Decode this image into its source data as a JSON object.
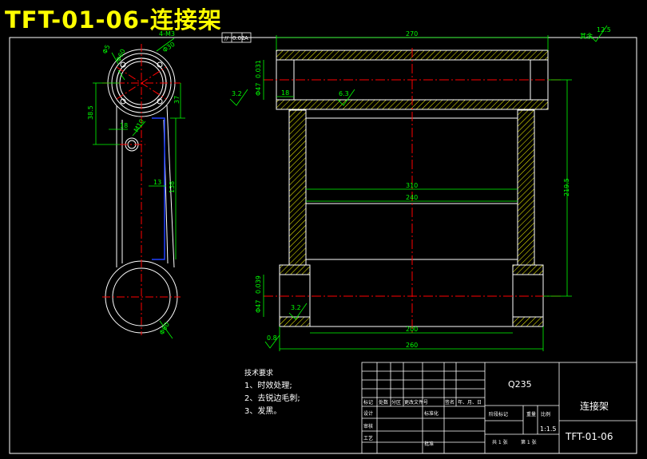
{
  "drawing_title": "TFT-01-06-连接架",
  "left_view": {
    "dims": [
      "4-M3",
      "Φ60",
      "Φ5",
      "Φ30",
      "38.5",
      "37",
      "18",
      "M10",
      "13",
      "138",
      "Φ60"
    ]
  },
  "front_view": {
    "dims_top": [
      "270",
      "18",
      "Φ47",
      "0.031",
      "3.2",
      "6.3"
    ],
    "dims_mid": [
      "310",
      "240",
      "219.5"
    ],
    "dims_bottom": [
      "Φ47",
      "0.039",
      "3.2",
      "200",
      "260",
      "0.8"
    ],
    "tolerance_frame": [
      "//",
      "0.02",
      "A"
    ],
    "roughness_note": [
      "其余",
      "12.5"
    ]
  },
  "technical_requirements": {
    "heading": "技术要求",
    "items": [
      "1、时效处理;",
      "2、去锐边毛刺;",
      "3、发黑。"
    ]
  },
  "title_block": {
    "material": "Q235",
    "part_name": "连接架",
    "drawing_number": "TFT-01-06",
    "scale": "1:1.5",
    "labels": [
      "标记",
      "处数",
      "分区",
      "更改文件号",
      "签名",
      "年、月、日",
      "设计",
      "标准化",
      "审核",
      "工艺",
      "批准",
      "阶段标记",
      "重量",
      "比例",
      "共 1 张",
      "第 1 张"
    ]
  },
  "colors": {
    "outline": "#ffffff",
    "dimension": "#00ff00",
    "centerline": "#ff0000",
    "hidden": "#0000ff",
    "hatch": "#ffff00",
    "title": "#ffff00"
  }
}
